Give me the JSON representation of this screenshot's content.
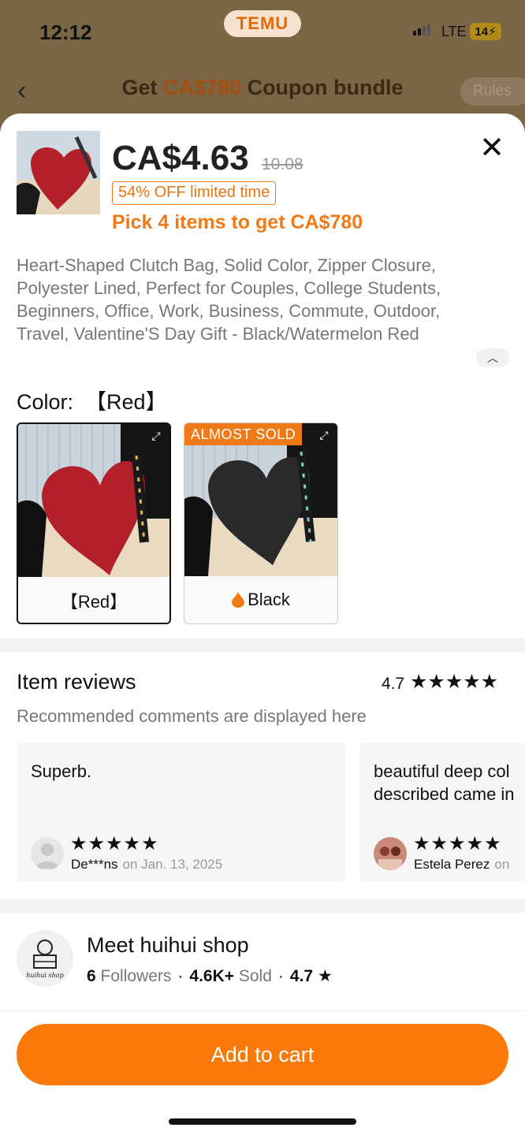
{
  "status_bar": {
    "time": "12:12",
    "network": "LTE",
    "battery": "14"
  },
  "app_badge": "TEMU",
  "background_nav": {
    "title_prefix": "Get ",
    "title_accent": "CA$780",
    "title_suffix": " Coupon bundle",
    "rules": "Rules"
  },
  "product": {
    "price": "CA$4.63",
    "original_price": "10.08",
    "discount_tag": "54% OFF limited time",
    "promo": "Pick 4 items to get CA$780",
    "title": "Heart-Shaped Clutch Bag, Solid Color, Zipper Closure, Polyester Lined, Perfect for Couples, College Students, Beginners, Office, Work, Business, Commute, Outdoor, Travel, Valentine'S Day Gift - Black/Watermelon Red"
  },
  "color": {
    "label": "Color:",
    "selected": "【Red】",
    "options": [
      {
        "label": "【Red】",
        "badge": "",
        "color": "#b3202a"
      },
      {
        "label": "Black",
        "badge": "ALMOST SOLD",
        "color": "#2a2a2a"
      }
    ]
  },
  "reviews": {
    "title": "Item reviews",
    "rating": "4.7",
    "stars": "★★★★★",
    "subtitle": "Recommended comments are displayed here",
    "items": [
      {
        "text": "Superb.",
        "stars": "★★★★★",
        "author": "De***ns",
        "date": "on Jan. 13, 2025"
      },
      {
        "text": "beautiful deep col\ndescribed came in",
        "stars": "★★★★★",
        "author": "Estela Perez",
        "date": "on"
      }
    ]
  },
  "shop": {
    "name": "Meet huihui shop",
    "logo_text": "huihui shop",
    "followers_count": "6",
    "followers_label": "Followers",
    "sold_count": "4.6K+",
    "sold_label": "Sold",
    "rating": "4.7",
    "star": "★"
  },
  "cta": {
    "add_to_cart": "Add to cart"
  },
  "colors": {
    "accent": "#f97a0a",
    "discount": "#f07a18"
  }
}
